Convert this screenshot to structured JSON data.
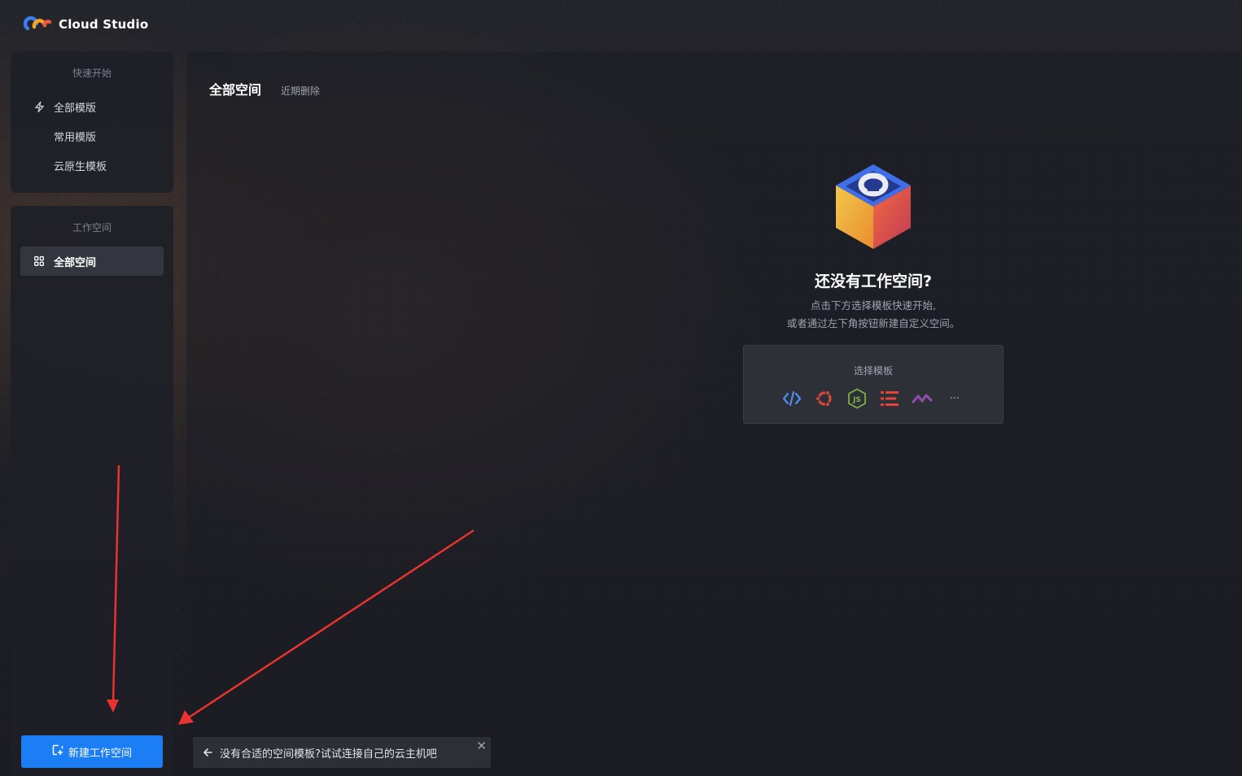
{
  "app": {
    "name": "Cloud Studio"
  },
  "sidebar": {
    "quick_start": {
      "title": "快速开始",
      "items": [
        {
          "label": "全部模版",
          "icon": "lightning-icon"
        },
        {
          "label": "常用模版"
        },
        {
          "label": "云原生模板"
        }
      ]
    },
    "workspace": {
      "title": "工作空间",
      "items": [
        {
          "label": "全部空间",
          "icon": "grid-icon",
          "active": true
        }
      ]
    },
    "new_workspace_button": "新建工作空间"
  },
  "main": {
    "tabs": [
      {
        "label": "全部空间",
        "active": true
      },
      {
        "label": "近期删除"
      }
    ],
    "empty_state": {
      "title": "还没有工作空间?",
      "desc_line1": "点击下方选择模板快速开始,",
      "desc_line2": "或者通过左下角按钮新建自定义空间。"
    },
    "template_picker": {
      "title": "选择模板",
      "icons": [
        "code-icon",
        "ubuntu-icon",
        "nodejs-icon",
        "list-icon",
        "wave-icon",
        "more-icon"
      ],
      "more_label": "···"
    }
  },
  "toast": {
    "text": "没有合适的空间模板?试试连接自己的云主机吧",
    "close": "✕"
  },
  "colors": {
    "accent": "#1b7ef4",
    "annotation_arrows": "#e8332f"
  }
}
